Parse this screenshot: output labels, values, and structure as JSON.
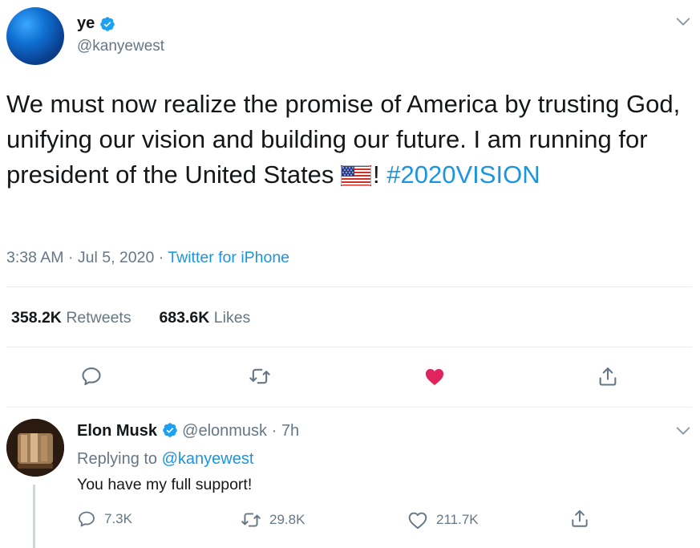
{
  "author": {
    "display_name": "ye",
    "handle": "@kanyewest",
    "verified": true
  },
  "tweet": {
    "text": "We must now realize the promise of America by trusting God, unifying our vision and building our future. I am running for president of the United States",
    "flag_emoji": "us-flag",
    "text_suffix": "!",
    "hashtag": "#2020VISION",
    "time": "3:38 AM",
    "separator": "·",
    "date": "Jul 5, 2020",
    "source": "Twitter for iPhone"
  },
  "stats": {
    "retweets_count": "358.2K",
    "retweets_label": "Retweets",
    "likes_count": "683.6K",
    "likes_label": "Likes"
  },
  "actions": {
    "reply_icon": "reply-icon",
    "retweet_icon": "retweet-icon",
    "like_icon": "heart-icon",
    "like_state": "liked",
    "share_icon": "share-icon"
  },
  "reply": {
    "name": "Elon Musk",
    "verified": true,
    "handle": "@elonmusk",
    "separator": "·",
    "time": "7h",
    "replying_to_label": "Replying to",
    "replying_to_handle": "@kanyewest",
    "text": "You have my full support!",
    "reply_count": "7.3K",
    "retweet_count": "29.8K",
    "like_count": "211.7K"
  },
  "colors": {
    "link": "#1b95e0",
    "muted": "#657786",
    "like_red": "#e0245e",
    "divider": "#e6ecf0"
  }
}
